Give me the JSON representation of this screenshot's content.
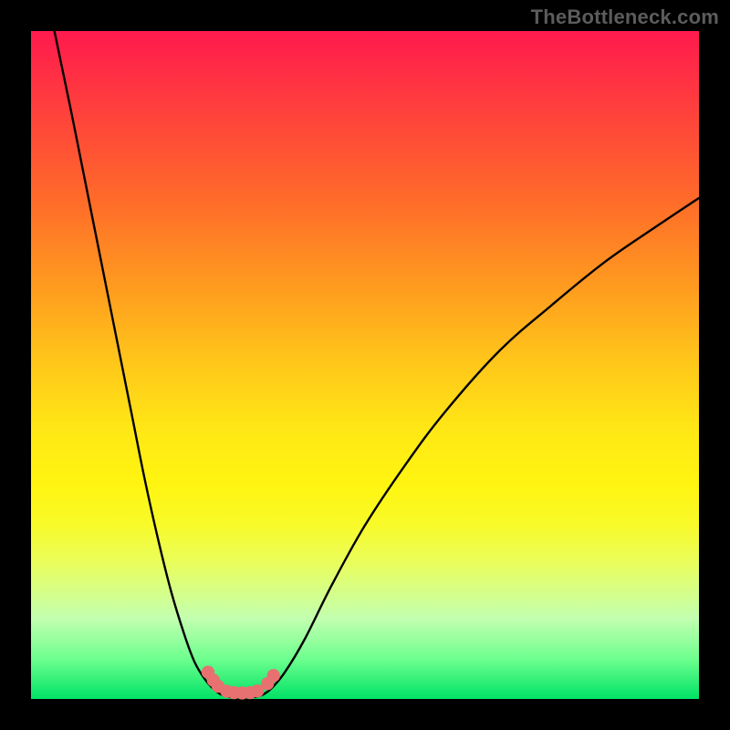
{
  "attribution": "TheBottleneck.com",
  "colors": {
    "background": "#000000",
    "gradient_top": "#ff1a4d",
    "gradient_bottom": "#00e266",
    "curve": "#000000",
    "marker": "#e77170"
  },
  "chart_data": {
    "type": "line",
    "title": "",
    "xlabel": "",
    "ylabel": "",
    "xlim": [
      0,
      100
    ],
    "ylim": [
      0,
      100
    ],
    "series": [
      {
        "name": "curve-left",
        "x": [
          3.5,
          6,
          9,
          12,
          15,
          17,
          19,
          21,
          23,
          24.5,
          26,
          27.2,
          28.2,
          29
        ],
        "y": [
          100,
          88,
          73,
          58,
          43,
          33,
          24,
          16,
          9.5,
          5.5,
          3,
          1.6,
          0.8,
          0.5
        ]
      },
      {
        "name": "curve-bottom",
        "x": [
          29,
          30,
          31,
          32,
          33,
          34,
          34.8
        ],
        "y": [
          0.5,
          0.25,
          0.2,
          0.2,
          0.25,
          0.4,
          0.7
        ]
      },
      {
        "name": "curve-right",
        "x": [
          34.8,
          36,
          38,
          41,
          45,
          50,
          56,
          62,
          70,
          78,
          86,
          94,
          100
        ],
        "y": [
          0.7,
          1.6,
          4,
          9,
          17,
          26,
          35,
          43,
          52,
          59,
          65.5,
          71,
          75
        ]
      }
    ],
    "markers": [
      {
        "x": 26.5,
        "y": 4.0
      },
      {
        "x": 27.3,
        "y": 2.8
      },
      {
        "x": 28.0,
        "y": 1.9
      },
      {
        "x": 29.3,
        "y": 1.15
      },
      {
        "x": 30.4,
        "y": 0.95
      },
      {
        "x": 31.6,
        "y": 0.9
      },
      {
        "x": 32.8,
        "y": 0.95
      },
      {
        "x": 33.9,
        "y": 1.2
      },
      {
        "x": 35.4,
        "y": 2.3
      },
      {
        "x": 36.3,
        "y": 3.5
      }
    ],
    "marker_radius": 7.2
  }
}
